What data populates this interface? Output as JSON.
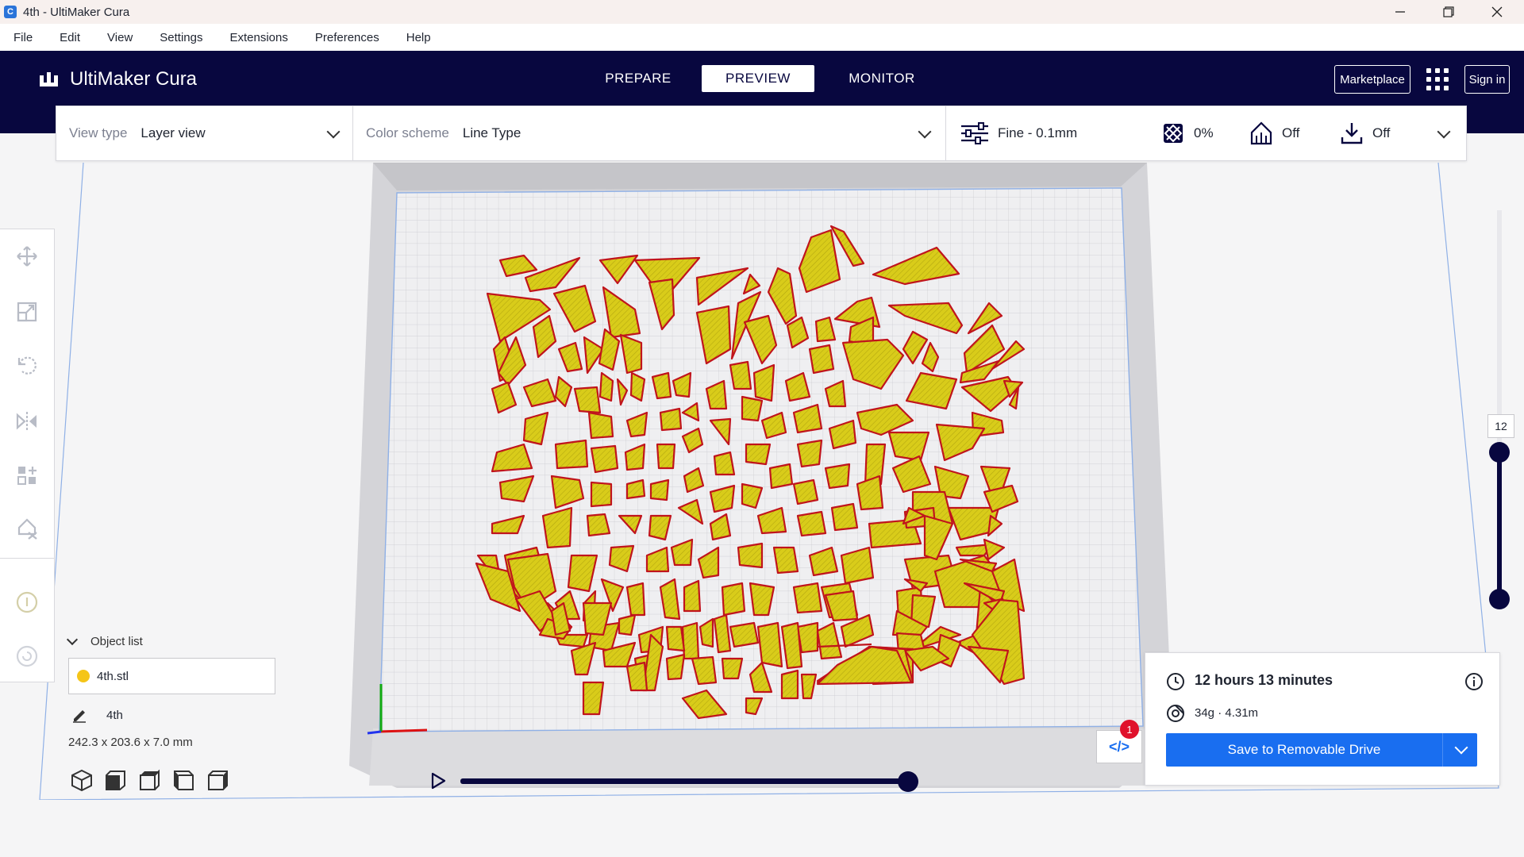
{
  "window": {
    "title": "4th - UltiMaker Cura"
  },
  "menu": {
    "items": [
      "File",
      "Edit",
      "View",
      "Settings",
      "Extensions",
      "Preferences",
      "Help"
    ]
  },
  "header": {
    "brand": "UltiMaker Cura",
    "stages": {
      "prepare": "PREPARE",
      "preview": "PREVIEW",
      "monitor": "MONITOR"
    },
    "marketplace": "Marketplace",
    "signin": "Sign in"
  },
  "toolbar": {
    "view_type_label": "View type",
    "view_type_value": "Layer view",
    "color_scheme_label": "Color scheme",
    "color_scheme_value": "Line Type",
    "profile": "Fine - 0.1mm",
    "infill": "0%",
    "support": "Off",
    "adhesion": "Off"
  },
  "objects": {
    "title": "Object list",
    "item": "4th.stl",
    "name": "4th",
    "dimensions": "242.3 x 203.6 x 7.0 mm"
  },
  "layer": {
    "current": "12"
  },
  "print": {
    "time": "12 hours 13 minutes",
    "material": "34g · 4.31m",
    "save_label": "Save to Removable Drive",
    "notification_count": "1"
  },
  "colors": {
    "header": "#08073f",
    "accent": "#196ef0",
    "model_fill": "#d9cc1a",
    "model_wall": "#c0141c"
  }
}
